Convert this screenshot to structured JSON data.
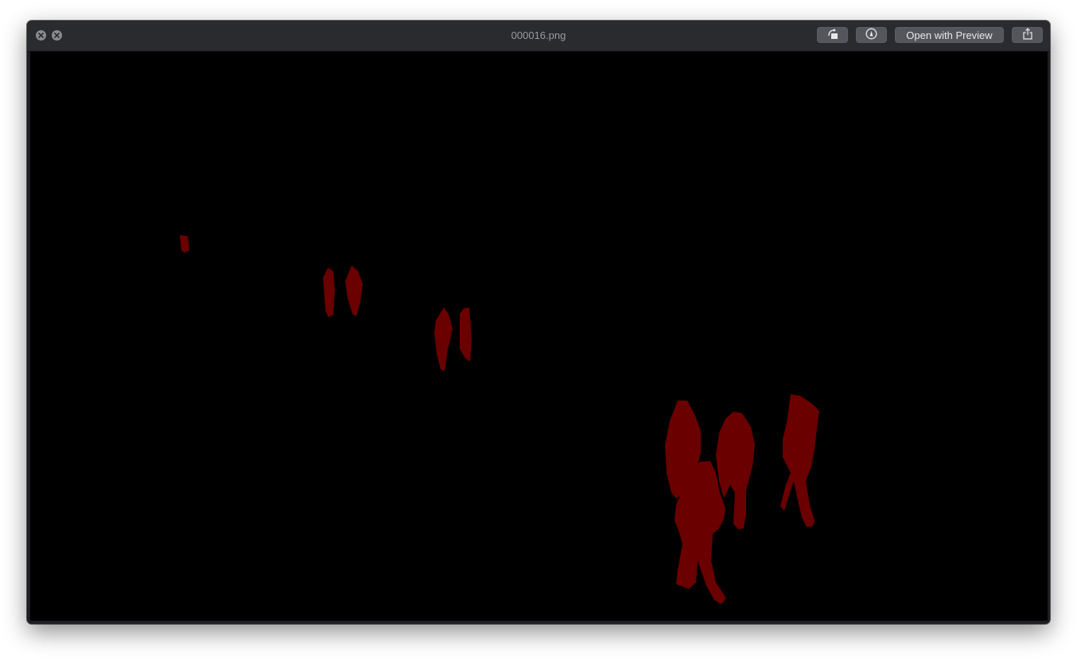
{
  "window": {
    "title": "000016.png"
  },
  "toolbar": {
    "close_icon": "close-icon",
    "fullscreen_icon": "fullscreen-icon",
    "rotate_icon": "rotate-icon",
    "markup_icon": "markup-icon",
    "open_label": "Open with Preview",
    "share_icon": "share-icon"
  },
  "image": {
    "background_color": "#000000",
    "mask_color": "#6b0000"
  }
}
